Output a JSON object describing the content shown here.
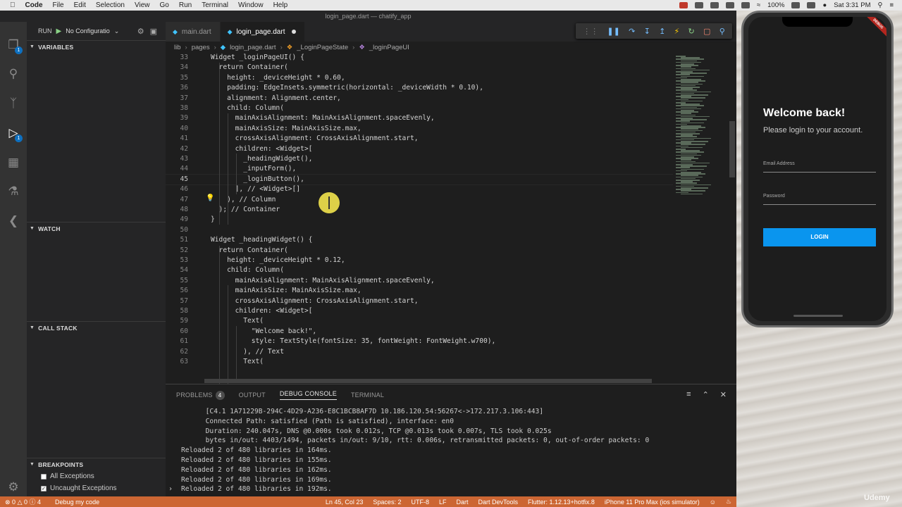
{
  "menubar": {
    "app_name": "Code",
    "items": [
      "File",
      "Edit",
      "Selection",
      "View",
      "Go",
      "Run",
      "Terminal",
      "Window",
      "Help"
    ],
    "battery": "100%",
    "clock": "Sat 3:31 PM"
  },
  "window": {
    "title": "login_page.dart — chatify_app"
  },
  "sidebar": {
    "run_label": "RUN",
    "config_label": "No Configuratio",
    "sections": {
      "variables": "VARIABLES",
      "watch": "WATCH",
      "call_stack": "CALL STACK",
      "breakpoints": "BREAKPOINTS"
    },
    "breakpoints": [
      {
        "label": "All Exceptions",
        "checked": false
      },
      {
        "label": "Uncaught Exceptions",
        "checked": true
      }
    ]
  },
  "activity_badges": {
    "explorer": "1",
    "debug": "1"
  },
  "tabs": [
    {
      "label": "main.dart",
      "active": false
    },
    {
      "label": "login_page.dart",
      "active": true,
      "modified": true
    }
  ],
  "breadcrumb": [
    "lib",
    "pages",
    "login_page.dart",
    "_LoginPageState",
    "_loginPageUI"
  ],
  "code_lines": [
    {
      "n": "33",
      "t": "Widget _loginPageUI() {"
    },
    {
      "n": "34",
      "t": "  return Container("
    },
    {
      "n": "35",
      "t": "    height: _deviceHeight * 0.60,"
    },
    {
      "n": "36",
      "t": "    padding: EdgeInsets.symmetric(horizontal: _deviceWidth * 0.10),"
    },
    {
      "n": "37",
      "t": "    alignment: Alignment.center,"
    },
    {
      "n": "38",
      "t": "    child: Column("
    },
    {
      "n": "39",
      "t": "      mainAxisAlignment: MainAxisAlignment.spaceEvenly,"
    },
    {
      "n": "40",
      "t": "      mainAxisSize: MainAxisSize.max,"
    },
    {
      "n": "41",
      "t": "      crossAxisAlignment: CrossAxisAlignment.start,"
    },
    {
      "n": "42",
      "t": "      children: <Widget>["
    },
    {
      "n": "43",
      "t": "        _headingWidget(),"
    },
    {
      "n": "44",
      "t": "        _inputForm(),"
    },
    {
      "n": "45",
      "t": "        _loginButton(),"
    },
    {
      "n": "46",
      "t": "      ], // <Widget>[]"
    },
    {
      "n": "47",
      "t": "    ), // Column"
    },
    {
      "n": "48",
      "t": "  ); // Container"
    },
    {
      "n": "49",
      "t": "}"
    },
    {
      "n": "50",
      "t": ""
    },
    {
      "n": "51",
      "t": "Widget _headingWidget() {"
    },
    {
      "n": "52",
      "t": "  return Container("
    },
    {
      "n": "53",
      "t": "    height: _deviceHeight * 0.12,"
    },
    {
      "n": "54",
      "t": "    child: Column("
    },
    {
      "n": "55",
      "t": "      mainAxisAlignment: MainAxisAlignment.spaceEvenly,"
    },
    {
      "n": "56",
      "t": "      mainAxisSize: MainAxisSize.max,"
    },
    {
      "n": "57",
      "t": "      crossAxisAlignment: CrossAxisAlignment.start,"
    },
    {
      "n": "58",
      "t": "      children: <Widget>["
    },
    {
      "n": "59",
      "t": "        Text("
    },
    {
      "n": "60",
      "t": "          \"Welcome back!\","
    },
    {
      "n": "61",
      "t": "          style: TextStyle(fontSize: 35, fontWeight: FontWeight.w700),"
    },
    {
      "n": "62",
      "t": "        ), // Text"
    },
    {
      "n": "63",
      "t": "        Text("
    }
  ],
  "panel": {
    "tabs": [
      "PROBLEMS",
      "OUTPUT",
      "DEBUG CONSOLE",
      "TERMINAL"
    ],
    "problems_count": "4",
    "console_lines": [
      "      [C4.1 1A71229B-294C-4D29-A236-E8C1BCB8AF7D 10.186.120.54:56267<->172.217.3.106:443]",
      "      Connected Path: satisfied (Path is satisfied), interface: en0",
      "      Duration: 240.047s, DNS @0.000s took 0.012s, TCP @0.013s took 0.007s, TLS took 0.025s",
      "      bytes in/out: 4403/1494, packets in/out: 9/10, rtt: 0.006s, retransmitted packets: 0, out-of-order packets: 0",
      "Reloaded 2 of 480 libraries in 164ms.",
      "Reloaded 2 of 480 libraries in 155ms.",
      "Reloaded 2 of 480 libraries in 162ms.",
      "Reloaded 2 of 480 libraries in 169ms.",
      "Reloaded 2 of 480 libraries in 192ms."
    ]
  },
  "statusbar": {
    "errors": "0",
    "warnings": "0",
    "infos": "4",
    "debug_label": "Debug my code",
    "position": "Ln 45, Col 23",
    "spaces": "Spaces: 2",
    "encoding": "UTF-8",
    "eol": "LF",
    "language": "Dart",
    "devtools": "Dart DevTools",
    "flutter": "Flutter: 1.12.13+hotfix.8",
    "device": "iPhone 11 Pro Max (ios simulator)"
  },
  "phone": {
    "title": "Welcome back!",
    "subtitle": "Please login to your account.",
    "email_label": "Email Address",
    "password_label": "Password",
    "login_label": "LOGIN",
    "debug_banner": "DEBUG"
  },
  "watermark": "Udemy",
  "colors": {
    "statusbar": "#cc6633",
    "accent_button": "#0a95ee"
  }
}
